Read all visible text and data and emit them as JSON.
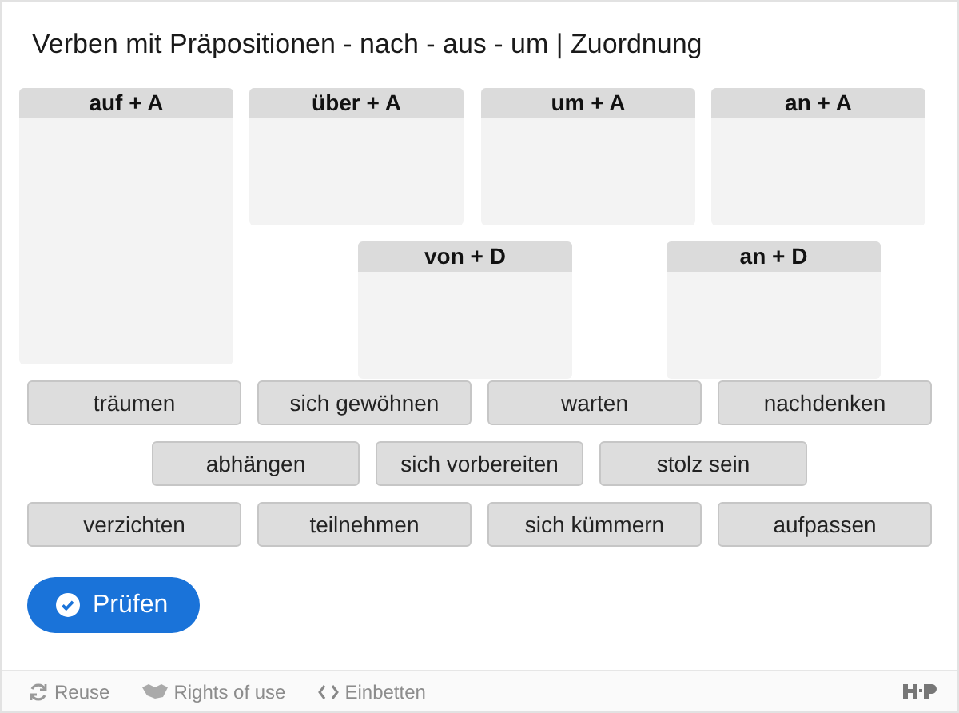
{
  "title": "Verben mit Präpositionen - nach - aus - um | Zuordnung",
  "drop_zones": [
    {
      "label": "auf + A",
      "kind": "tall"
    },
    {
      "label": "über + A",
      "kind": "short"
    },
    {
      "label": "um + A",
      "kind": "short"
    },
    {
      "label": "an + A",
      "kind": "short"
    },
    {
      "label": "von + D",
      "kind": "short"
    },
    {
      "label": "an + D",
      "kind": "short"
    }
  ],
  "draggable_rows": [
    [
      "träumen",
      "sich gewöhnen",
      "warten",
      "nachdenken"
    ],
    [
      "abhängen",
      "sich vorbereiten",
      "stolz sein"
    ],
    [
      "verzichten",
      "teilnehmen",
      "sich kümmern",
      "aufpassen"
    ]
  ],
  "check_button": "Prüfen",
  "footer": {
    "links": [
      {
        "kind": "reuse",
        "label": "Reuse"
      },
      {
        "kind": "rights",
        "label": "Rights of use"
      },
      {
        "kind": "embed",
        "label": "Einbetten"
      }
    ]
  }
}
